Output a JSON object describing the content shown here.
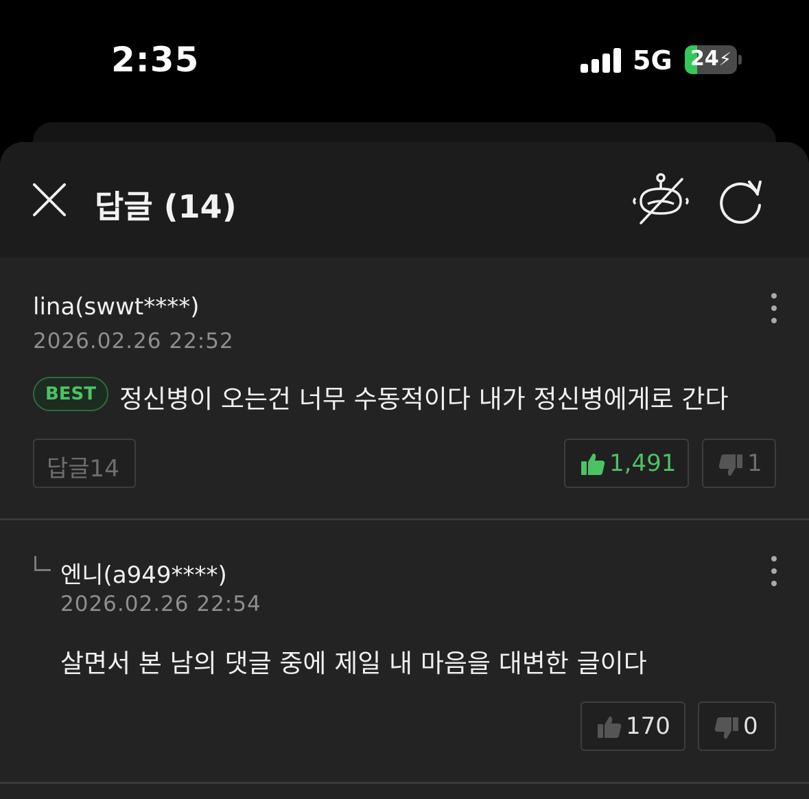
{
  "status_bar": {
    "time": "2:35",
    "network": "5G",
    "battery_percent": "24",
    "battery_level": 0.24,
    "charging": true
  },
  "header": {
    "title": "답글 (14)",
    "close_icon": "close-icon",
    "bot_icon": "robot-hidden-icon",
    "refresh_icon": "refresh-icon"
  },
  "comments": [
    {
      "author": "lina(swwt****)",
      "date": "2026.02.26 22:52",
      "badge": "BEST",
      "text": "정신병이 오는건 너무 수동적이다 내가 정신병에게로 간다",
      "reply_label": "답글14",
      "likes": "1,491",
      "dislikes": "1"
    },
    {
      "author": "엔니(a949****)",
      "date": "2026.02.26 22:54",
      "text": "살면서 본 남의 댓글 중에 제일 내 마음을 대변한 글이다",
      "likes": "170",
      "dislikes": "0"
    }
  ],
  "colors": {
    "accent_green": "#4cc264",
    "sheet_bg": "#232323",
    "header_bg": "#1c1c1c"
  }
}
